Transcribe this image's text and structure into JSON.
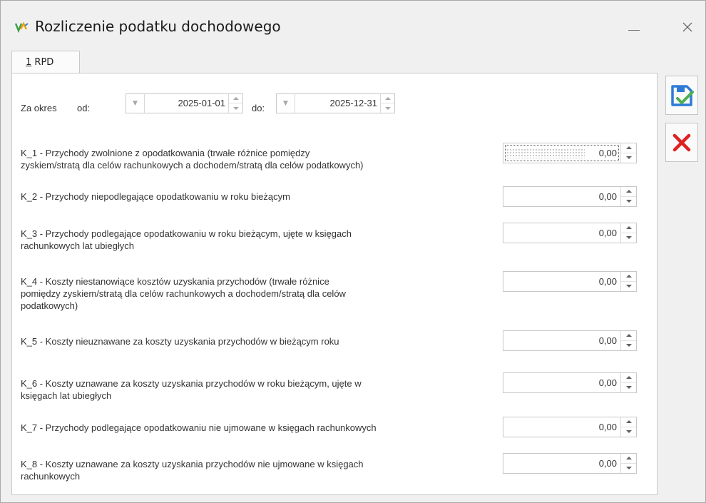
{
  "window": {
    "title": "Rozliczenie podatku dochodowego"
  },
  "tab": {
    "number": "1",
    "label": " RPD"
  },
  "period": {
    "label": "Za okres",
    "from_label": "od:",
    "from_value": "2025-01-01",
    "to_label": "do:",
    "to_value": "2025-12-31"
  },
  "rows": [
    {
      "code": "K_1",
      "text_lines": [
        "K_1 - Przychody zwolnione z opodatkowania (trwałe różnice pomiędzy",
        "zyskiem/stratą dla celów rachunkowych a dochodem/stratą dla celów podatkowych)"
      ],
      "value": "0,00"
    },
    {
      "code": "K_2",
      "text_lines": [
        "K_2 - Przychody niepodlegające opodatkowaniu w roku bieżącym"
      ],
      "value": "0,00"
    },
    {
      "code": "K_3",
      "text_lines": [
        "K_3 - Przychody podlegające opodatkowaniu w roku bieżącym, ujęte w księgach",
        "rachunkowych lat ubiegłych"
      ],
      "value": "0,00"
    },
    {
      "code": "K_4",
      "text_lines": [
        "K_4 - Koszty niestanowiące kosztów uzyskania przychodów (trwałe różnice",
        "pomiędzy zyskiem/stratą dla celów rachunkowych a dochodem/stratą dla celów",
        "podatkowych)"
      ],
      "value": "0,00"
    },
    {
      "code": "K_5",
      "text_lines": [
        "K_5 - Koszty nieuznawane za koszty uzyskania przychodów w bieżącym roku"
      ],
      "value": "0,00"
    },
    {
      "code": "K_6",
      "text_lines": [
        "K_6 - Koszty uznawane za koszty uzyskania przychodów w roku bieżącym, ujęte w",
        "księgach lat ubiegłych"
      ],
      "value": "0,00"
    },
    {
      "code": "K_7",
      "text_lines": [
        "K_7 - Przychody podlegające opodatkowaniu nie ujmowane w księgach rachunkowych"
      ],
      "value": "0,00"
    },
    {
      "code": "K_8",
      "text_lines": [
        "K_8 - Koszty uznawane za koszty uzyskania przychodów nie ujmowane w księgach",
        "rachunkowych"
      ],
      "value": "0,00"
    }
  ],
  "colors": {
    "save_icon": "#2e7bd6",
    "save_check": "#4caf50",
    "cancel_icon": "#e02020"
  },
  "icons": {
    "app": "app-logo-icon",
    "minimize": "minimize-icon",
    "close": "close-icon",
    "save": "save-icon",
    "cancel": "cancel-icon"
  }
}
